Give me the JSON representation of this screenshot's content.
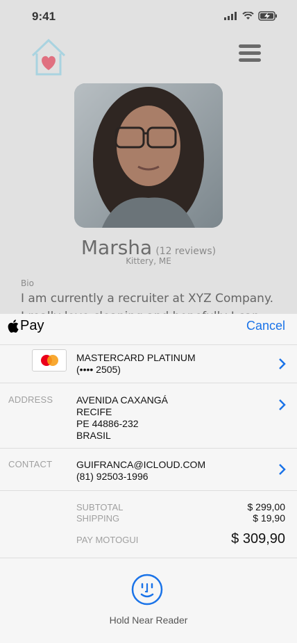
{
  "status_bar": {
    "time": "9:41"
  },
  "profile": {
    "name": "Marsha",
    "reviews": "(12 reviews)",
    "location": "Kittery, ME",
    "bio_label": "Bio",
    "bio": "I am currently a recruiter at XYZ Company. I really love cleaning and hopefully I can help"
  },
  "pay_sheet": {
    "brand": "Pay",
    "cancel_label": "Cancel",
    "card": {
      "name": "MASTERCARD PLATINUM",
      "number": "(•••• 2505)"
    },
    "address": {
      "label": "ADDRESS",
      "lines": [
        "AVENIDA CAXANGÁ",
        "RECIFE",
        "PE 44886-232",
        "BRASIL"
      ]
    },
    "contact": {
      "label": "CONTACT",
      "lines": [
        "GUIFRANCA@ICLOUD.COM",
        "(81) 92503-1996"
      ]
    },
    "totals": {
      "subtotal_label": "SUBTOTAL",
      "subtotal": "$ 299,00",
      "shipping_label": "SHIPPING",
      "shipping": "$ 19,90",
      "pay_label": "PAY MOTOGUI",
      "total": "$ 309,90"
    },
    "hold_text": "Hold Near Reader"
  },
  "colors": {
    "accent": "#1a73e8",
    "heart": "#e85a6a",
    "house": "#a9d3e0"
  }
}
